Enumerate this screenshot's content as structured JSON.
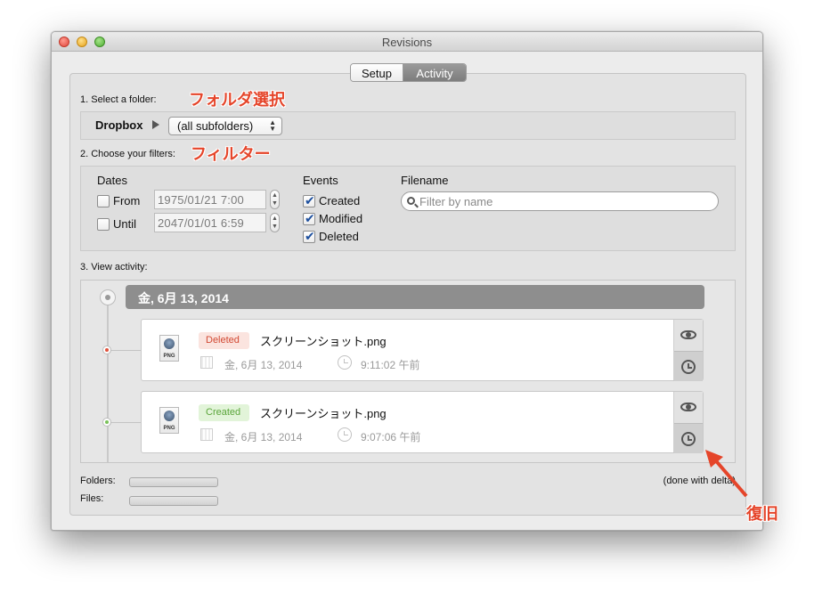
{
  "window": {
    "title": "Revisions"
  },
  "tabs": {
    "setup": "Setup",
    "activity": "Activity",
    "selected": "Activity"
  },
  "section1": {
    "label": "1. Select a folder:",
    "annotation": "フォルダ選択",
    "folder": "Dropbox",
    "popup_value": "(all subfolders)"
  },
  "section2": {
    "label": "2. Choose your filters:",
    "annotation": "フィルター",
    "dates": {
      "heading": "Dates",
      "from": {
        "label": "From",
        "checked": false,
        "value": "1975/01/21   7:00"
      },
      "until": {
        "label": "Until",
        "checked": false,
        "value": "2047/01/01   6:59"
      }
    },
    "events": {
      "heading": "Events",
      "created": {
        "label": "Created",
        "checked": true
      },
      "modified": {
        "label": "Modified",
        "checked": true
      },
      "deleted": {
        "label": "Deleted",
        "checked": true
      }
    },
    "filename": {
      "heading": "Filename",
      "placeholder": "Filter by name"
    }
  },
  "section3": {
    "label": "3. View activity:",
    "date_header": "金, 6月 13, 2014",
    "items": [
      {
        "badge": "Deleted",
        "event": "deleted",
        "filename": "スクリーンショット.png",
        "date": "金, 6月 13, 2014",
        "time": "9:11:02 午前",
        "file_type": "PNG",
        "icon": "png-file-icon"
      },
      {
        "badge": "Created",
        "event": "created",
        "filename": "スクリーンショット.png",
        "date": "金, 6月 13, 2014",
        "time": "9:07:06 午前",
        "file_type": "PNG",
        "icon": "png-file-icon"
      }
    ]
  },
  "footer": {
    "folders_label": "Folders:",
    "files_label": "Files:",
    "status": "(done with delta)"
  },
  "callout": {
    "text": "復旧"
  },
  "colors": {
    "annotation": "#e5452a",
    "deleted": "#d24a34",
    "created": "#5aa53a",
    "date_bar": "#8e8e8e"
  }
}
